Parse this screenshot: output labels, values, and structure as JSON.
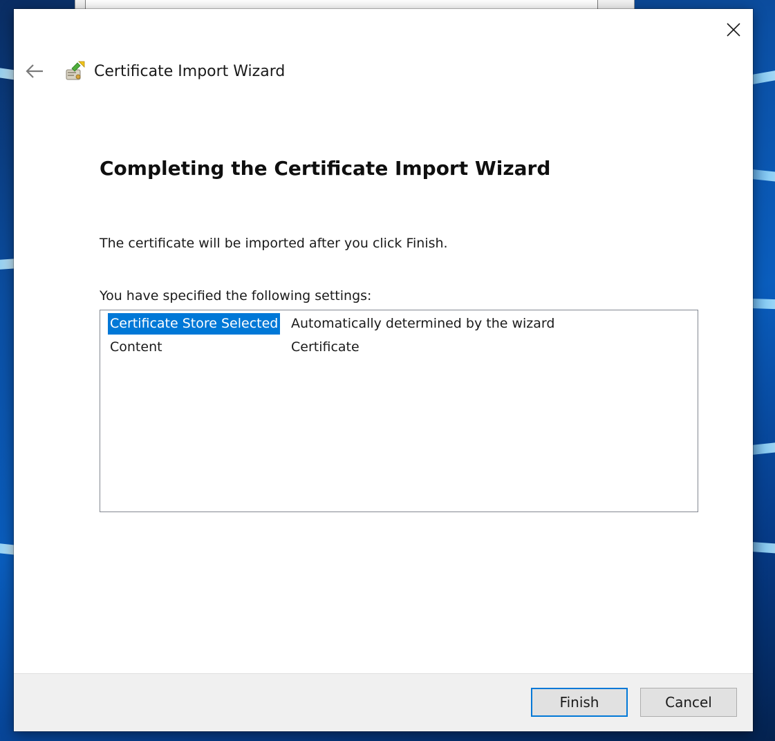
{
  "window": {
    "title": "Certificate Import Wizard",
    "close_icon": "close-icon",
    "back_icon": "back-arrow-icon",
    "app_icon": "certificate-import-icon"
  },
  "page": {
    "heading": "Completing the Certificate Import Wizard",
    "description": "The certificate will be imported after you click Finish.",
    "settings_label": "You have specified the following settings:"
  },
  "settings": {
    "rows": [
      {
        "key": "Certificate Store Selected",
        "value": "Automatically determined by the wizard",
        "selected": true
      },
      {
        "key": "Content",
        "value": "Certificate",
        "selected": false
      }
    ]
  },
  "buttons": {
    "finish_label": "Finish",
    "cancel_label": "Cancel"
  },
  "colors": {
    "accent": "#0078d7",
    "footer_bg": "#f0f0f0",
    "button_bg": "#e1e1e1"
  }
}
